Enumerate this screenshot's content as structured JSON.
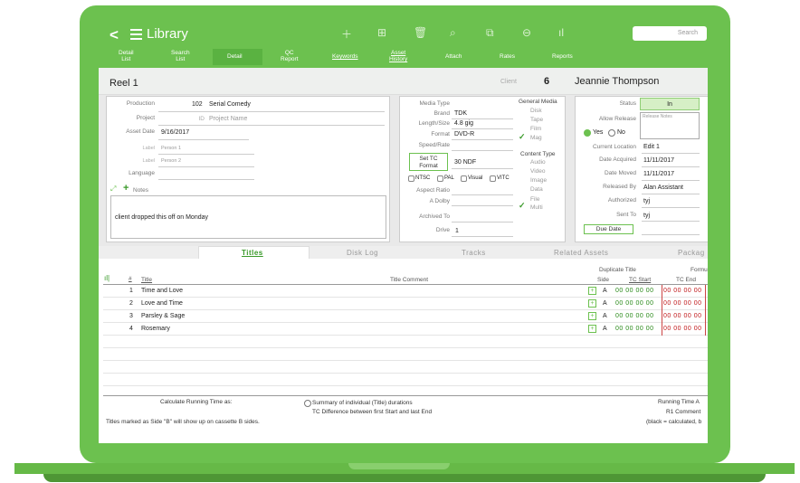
{
  "nav": {
    "back": "<",
    "title": "Library",
    "search_placeholder": "Search",
    "icons": [
      "plus-icon",
      "grid-icon",
      "trash-icon",
      "search-icon",
      "copy-icon",
      "more-icon",
      "chart-icon"
    ],
    "tabs": [
      "Detail\nList",
      "Search\nList",
      "Detail",
      "QC\nReport",
      "Keywords",
      "Asset\nHistory",
      "Attach",
      "Rates",
      "Reports"
    ]
  },
  "header": {
    "reel": "Reel 1",
    "client_label": "Client",
    "client_num": "6",
    "client_name": "Jeannie Thompson"
  },
  "left": {
    "production_label": "Production",
    "production_id": "102",
    "production_name": "Serial Comedy",
    "project_label": "Project",
    "id_label": "ID",
    "project_name_placeholder": "Project Name",
    "asset_date_label": "Asset Date",
    "asset_date": "9/16/2017",
    "label1": "Label",
    "person1": "Person 1",
    "label2": "Label",
    "person2": "Person 2",
    "language_label": "Language",
    "notes_label": "Notes",
    "notes_text": "client dropped this off on Monday"
  },
  "mid": {
    "media_type_label": "Media Type",
    "brand_label": "Brand",
    "brand": "TDK",
    "length_label": "Length/Size",
    "length": "4.8 gig",
    "format_label": "Format",
    "format": "DVD-R",
    "speed_label": "Speed/Rate",
    "set_tc": "Set TC\nFormat",
    "tc_format": "30 NDF",
    "checks": [
      "NTSC",
      "PAL",
      "Visual",
      "VITC"
    ],
    "aspect_label": "Aspect Ratio",
    "dolby_label": "A Dolby",
    "archived_label": "Archived To",
    "drive_label": "Drive",
    "drive": "1",
    "general_media_label": "General Media",
    "general_media": [
      "Disk",
      "Tape",
      "Film",
      "Mag"
    ],
    "content_type_label": "Content Type",
    "content_types": [
      "Audio",
      "Video",
      "Image",
      "Data",
      "File\nMulti"
    ]
  },
  "right": {
    "status_label": "Status",
    "status": "In",
    "allow_release_label": "Allow Release",
    "release_notes_label": "Release Notes",
    "yes": "Yes",
    "no": "No",
    "location_label": "Current Location",
    "location": "Edit 1",
    "acquired_label": "Date Acquired",
    "acquired": "11/11/2017",
    "moved_label": "Date Moved",
    "moved": "11/11/2017",
    "released_label": "Released By",
    "released": "Alan Assistant",
    "authorized_label": "Authorized",
    "authorized": "tyj",
    "sent_label": "Sent To",
    "sent": "tyj",
    "due_date": "Due Date"
  },
  "subtabs": [
    "Titles",
    "Disk Log",
    "Tracks",
    "Related Assets",
    "Packag"
  ],
  "titles": {
    "hash": "#",
    "title_col": "Title",
    "comment_col": "Title Comment",
    "dup_col": "Duplicate Title",
    "side_col": "Side",
    "tc_start_col": "TC Start",
    "tc_end_col": "TC End",
    "format_col": "Formu",
    "rows": [
      {
        "n": "1",
        "title": "Time and Love",
        "side": "A",
        "start": "00 00 00 00",
        "end": "00 00 00 00"
      },
      {
        "n": "2",
        "title": "Love and Time",
        "side": "A",
        "start": "00 00 00 00",
        "end": "00 00 00 00"
      },
      {
        "n": "3",
        "title": "Parsley & Sage",
        "side": "A",
        "start": "00 00 00 00",
        "end": "00 00 00 00"
      },
      {
        "n": "4",
        "title": "Rosemary",
        "side": "A",
        "start": "00 00 00 00",
        "end": "00 00 00 00"
      }
    ]
  },
  "footer": {
    "calc_label": "Calculate Running Time as:",
    "opt1": "Summary of individual (Title) durations",
    "opt2": "TC Difference between first Start and last End",
    "note": "Titles marked as Side \"B\" will show up on cassette B sides.",
    "running_time": "Running Time A",
    "r1": "R1 Comment",
    "legend": "(black = calculated, b"
  }
}
